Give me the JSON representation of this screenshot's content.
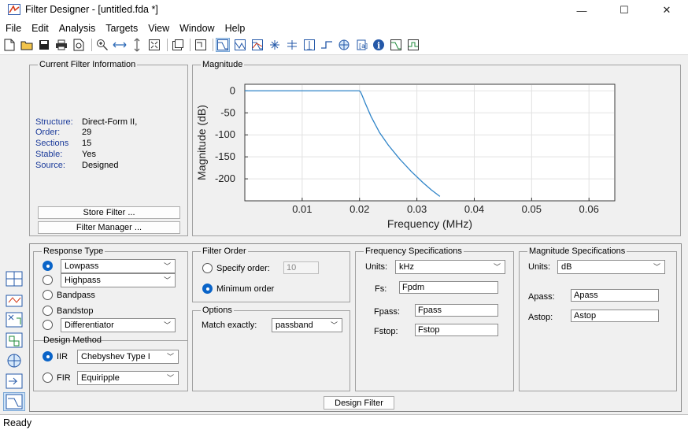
{
  "window": {
    "title": "Filter Designer -  [untitled.fda *]",
    "minimize": "—",
    "maximize": "☐",
    "close": "✕"
  },
  "menu": [
    "File",
    "Edit",
    "Analysis",
    "Targets",
    "View",
    "Window",
    "Help"
  ],
  "current_filter": {
    "legend": "Current Filter Information",
    "rows": [
      {
        "label": "Structure:",
        "value": "Direct-Form II,"
      },
      {
        "label": "Order:",
        "value": "29"
      },
      {
        "label": "Sections",
        "value": "15"
      },
      {
        "label": "Stable:",
        "value": "Yes"
      },
      {
        "label": "Source:",
        "value": "Designed"
      }
    ],
    "store_button": "Store Filter ...",
    "manager_button": "Filter Manager ..."
  },
  "magnitude": {
    "legend": "Magnitude",
    "chart_data": {
      "type": "line",
      "xlabel": "Frequency (MHz)",
      "ylabel": "Magnitude (dB)",
      "x_ticks": [
        "0.01",
        "0.02",
        "0.03",
        "0.04",
        "0.05",
        "0.06"
      ],
      "y_ticks": [
        "0",
        "-50",
        "-100",
        "-150",
        "-200"
      ],
      "xlim": [
        0,
        0.0645
      ],
      "ylim": [
        -250,
        15
      ],
      "grid": true,
      "series": [
        {
          "color": "#2f84c8",
          "x": [
            0,
            0.0185,
            0.0195,
            0.02,
            0.0202,
            0.0205,
            0.021,
            0.022,
            0.0235,
            0.025,
            0.027,
            0.029,
            0.031,
            0.0325,
            0.034
          ],
          "y": [
            0,
            0,
            0,
            0,
            -3,
            -12,
            -28,
            -58,
            -95,
            -123,
            -155,
            -183,
            -208,
            -225,
            -240
          ]
        }
      ]
    }
  },
  "response_type": {
    "legend": "Response Type",
    "options": [
      {
        "label": "Lowpass",
        "selected": true,
        "dropdown": true
      },
      {
        "label": "Highpass",
        "selected": false,
        "dropdown": true
      },
      {
        "label": "Bandpass",
        "selected": false,
        "dropdown": false
      },
      {
        "label": "Bandstop",
        "selected": false,
        "dropdown": false
      },
      {
        "label": "Differentiator",
        "selected": false,
        "dropdown": true
      }
    ]
  },
  "design_method": {
    "legend": "Design Method",
    "iir_label": "IIR",
    "iir_value": "Chebyshev Type I",
    "fir_label": "FIR",
    "fir_value": "Equiripple",
    "selected": "IIR"
  },
  "filter_order": {
    "legend": "Filter Order",
    "specify_label": "Specify order:",
    "specify_value": "10",
    "minimum_label": "Minimum order",
    "selected": "minimum"
  },
  "options": {
    "legend": "Options",
    "match_label": "Match exactly:",
    "match_value": "passband"
  },
  "frequency_specs": {
    "legend": "Frequency Specifications",
    "units_label": "Units:",
    "units_value": "kHz",
    "fs_label": "Fs:",
    "fs_value": "Fpdm",
    "fpass_label": "Fpass:",
    "fpass_value": "Fpass",
    "fstop_label": "Fstop:",
    "fstop_value": "Fstop"
  },
  "magnitude_specs": {
    "legend": "Magnitude Specifications",
    "units_label": "Units:",
    "units_value": "dB",
    "apass_label": "Apass:",
    "apass_value": "Apass",
    "astop_label": "Astop:",
    "astop_value": "Astop"
  },
  "design_button": "Design Filter",
  "status": "Ready"
}
